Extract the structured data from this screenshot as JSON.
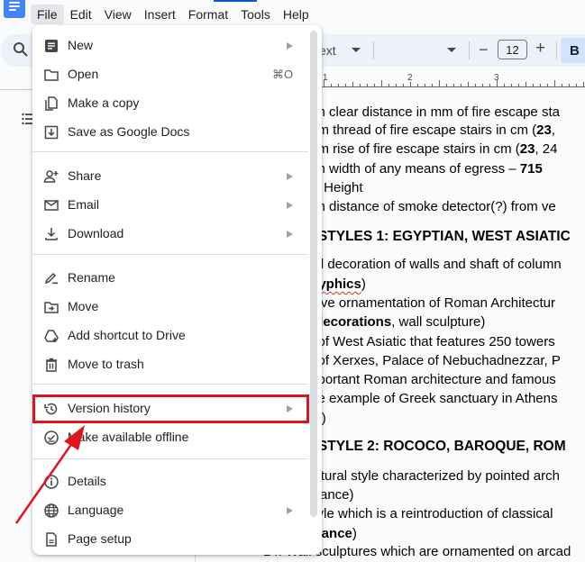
{
  "menubar": {
    "items": [
      {
        "label": "File",
        "active": true
      },
      {
        "label": "Edit"
      },
      {
        "label": "View"
      },
      {
        "label": "Insert"
      },
      {
        "label": "Format"
      },
      {
        "label": "Tools"
      },
      {
        "label": "Help"
      }
    ]
  },
  "toolbar": {
    "style_text": "ext",
    "font_size": "12",
    "minus": "−",
    "plus": "+",
    "bold": "B"
  },
  "ruler": {
    "labels": [
      "1",
      "2",
      "3"
    ]
  },
  "file_menu": {
    "items": [
      {
        "label": "New",
        "icon": "doc-icon",
        "submenu": true
      },
      {
        "label": "Open",
        "icon": "folder-icon",
        "shortcut": "⌘O"
      },
      {
        "label": "Make a copy",
        "icon": "copy-icon"
      },
      {
        "label": "Save as Google Docs",
        "icon": "save-download-icon"
      },
      {
        "label": "Share",
        "icon": "person-add-icon",
        "submenu": true
      },
      {
        "label": "Email",
        "icon": "mail-icon",
        "submenu": true
      },
      {
        "label": "Download",
        "icon": "download-icon",
        "submenu": true
      },
      {
        "label": "Rename",
        "icon": "rename-pencil-icon"
      },
      {
        "label": "Move",
        "icon": "move-folder-icon"
      },
      {
        "label": "Add shortcut to Drive",
        "icon": "drive-shortcut-icon"
      },
      {
        "label": "Move to trash",
        "icon": "trash-icon"
      },
      {
        "label": "Version history",
        "icon": "history-icon",
        "submenu": true,
        "highlighted": true
      },
      {
        "label": "Make available offline",
        "icon": "offline-check-icon"
      },
      {
        "label": "Details",
        "icon": "info-icon"
      },
      {
        "label": "Language",
        "icon": "globe-icon",
        "submenu": true
      },
      {
        "label": "Page setup",
        "icon": "page-icon"
      }
    ]
  },
  "annotation": {
    "highlight_color": "#e0141e",
    "target": "Version history"
  },
  "document": {
    "lines": [
      {
        "parts": [
          {
            "t": "um clear distance in mm of fire escape sta"
          }
        ]
      },
      {
        "parts": [
          {
            "t": "ıum thread of fire escape stairs in cm ("
          },
          {
            "t": "23",
            "b": true
          },
          {
            "t": ", "
          }
        ]
      },
      {
        "parts": [
          {
            "t": "ıum rise of fire escape stairs in cm ("
          },
          {
            "t": "23",
            "b": true
          },
          {
            "t": ", 24"
          }
        ]
      },
      {
        "parts": [
          {
            "t": "um width of any means of egress – "
          },
          {
            "t": "715",
            "b": true
          }
        ]
      },
      {
        "parts": [
          {
            "t": "ail Height"
          }
        ]
      },
      {
        "parts": [
          {
            "t": "um distance of smoke detector(?) from ve"
          }
        ]
      },
      {
        "parts": [
          {
            "t": "_ STYLES 1: EGYPTIAN, WEST ASIATIC"
          }
        ],
        "head": true
      },
      {
        "parts": [
          {
            "t": "ɔal decoration of walls and shaft of column"
          }
        ]
      },
      {
        "parts": [
          {
            "t": "glyphics",
            "b": true,
            "squig": true
          },
          {
            "t": ")"
          }
        ]
      },
      {
        "parts": [
          {
            "t": "ative ornamentation of Roman Architectur"
          }
        ]
      },
      {
        "parts": [
          {
            "t": "› decorations",
            "b": true
          },
          {
            "t": ", wall sculpture)"
          }
        ]
      },
      {
        "parts": [
          {
            "t": "e of West Asiatic that features 250 towers"
          }
        ]
      },
      {
        "parts": [
          {
            "t": "e of Xerxes, Palace of Nebuchadnezzar, P"
          }
        ]
      },
      {
        "parts": [
          {
            "t": "mportant Roman architecture and famous"
          }
        ]
      },
      {
        "parts": [
          {
            "t": "me example of Greek sanctuary in Athens"
          }
        ]
      },
      {
        "parts": [
          {
            "t": "ea",
            "squig": true
          },
          {
            "t": ")"
          }
        ]
      },
      {
        "parts": [
          {
            "t": "_ STYLE 2: ROCOCO, BAROQUE, ROM"
          }
        ],
        "head": true
      },
      {
        "parts": [
          {
            "t": "ectural style characterized by pointed arch"
          }
        ]
      },
      {
        "parts": [
          {
            "t": "ssance)"
          }
        ]
      },
      {
        "parts": [
          {
            "t": " style which is a reintroduction of classical"
          }
        ]
      },
      {
        "parts": [
          {
            "t": "ssance",
            "b": true
          },
          {
            "t": ")"
          }
        ]
      },
      {
        "parts": [
          {
            "t": "14.  Wall sculptures which are ornamented on arcad"
          }
        ]
      }
    ]
  }
}
